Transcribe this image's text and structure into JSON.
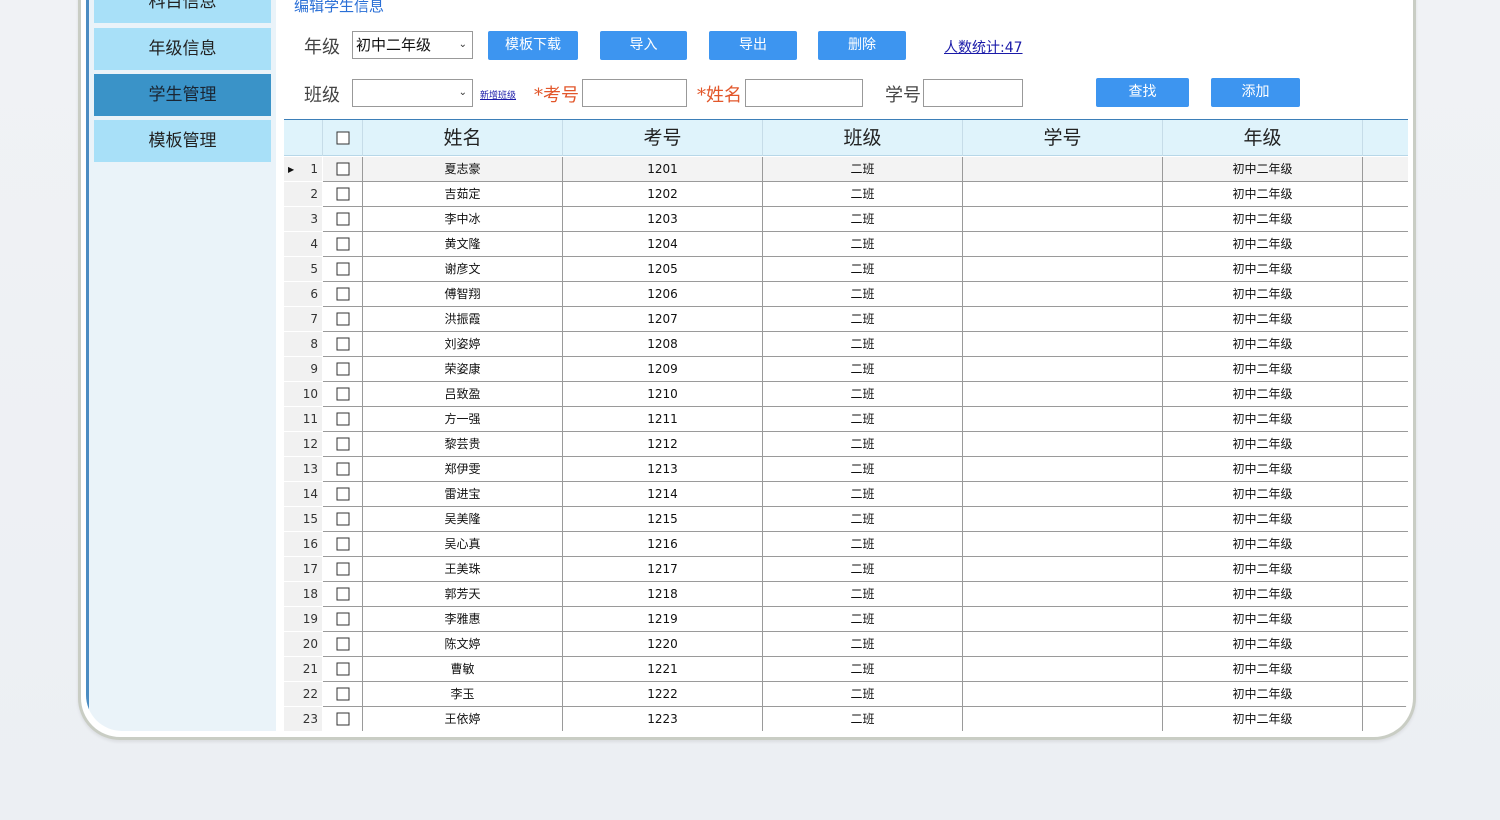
{
  "sidebar": {
    "items": [
      {
        "label": "科目信息"
      },
      {
        "label": "年级信息"
      },
      {
        "label": "学生管理"
      },
      {
        "label": "模板管理"
      }
    ]
  },
  "header": {
    "link_label": "编辑学生信息"
  },
  "filters": {
    "grade_label": "年级",
    "grade_value": "初中二年级",
    "class_label": "班级",
    "class_value": "",
    "add_class_link": "新增班级",
    "exam_no_label": "*考号",
    "name_label": "*姓名",
    "student_no_label": "学号"
  },
  "toolbar": {
    "template_download": "模板下载",
    "import": "导入",
    "export": "导出",
    "delete": "删除",
    "count_label": "人数统计:47",
    "search": "查找",
    "add": "添加"
  },
  "table": {
    "columns": [
      "姓名",
      "考号",
      "班级",
      "学号",
      "年级"
    ],
    "rows": [
      {
        "n": "1",
        "name": "夏志豪",
        "exam": "1201",
        "class": "二班",
        "sno": "",
        "grade": "初中二年级"
      },
      {
        "n": "2",
        "name": "吉茹定",
        "exam": "1202",
        "class": "二班",
        "sno": "",
        "grade": "初中二年级"
      },
      {
        "n": "3",
        "name": "李中冰",
        "exam": "1203",
        "class": "二班",
        "sno": "",
        "grade": "初中二年级"
      },
      {
        "n": "4",
        "name": "黄文隆",
        "exam": "1204",
        "class": "二班",
        "sno": "",
        "grade": "初中二年级"
      },
      {
        "n": "5",
        "name": "谢彦文",
        "exam": "1205",
        "class": "二班",
        "sno": "",
        "grade": "初中二年级"
      },
      {
        "n": "6",
        "name": "傅智翔",
        "exam": "1206",
        "class": "二班",
        "sno": "",
        "grade": "初中二年级"
      },
      {
        "n": "7",
        "name": "洪振霞",
        "exam": "1207",
        "class": "二班",
        "sno": "",
        "grade": "初中二年级"
      },
      {
        "n": "8",
        "name": "刘姿婷",
        "exam": "1208",
        "class": "二班",
        "sno": "",
        "grade": "初中二年级"
      },
      {
        "n": "9",
        "name": "荣姿康",
        "exam": "1209",
        "class": "二班",
        "sno": "",
        "grade": "初中二年级"
      },
      {
        "n": "10",
        "name": "吕致盈",
        "exam": "1210",
        "class": "二班",
        "sno": "",
        "grade": "初中二年级"
      },
      {
        "n": "11",
        "name": "方一强",
        "exam": "1211",
        "class": "二班",
        "sno": "",
        "grade": "初中二年级"
      },
      {
        "n": "12",
        "name": "黎芸贵",
        "exam": "1212",
        "class": "二班",
        "sno": "",
        "grade": "初中二年级"
      },
      {
        "n": "13",
        "name": "郑伊雯",
        "exam": "1213",
        "class": "二班",
        "sno": "",
        "grade": "初中二年级"
      },
      {
        "n": "14",
        "name": "雷进宝",
        "exam": "1214",
        "class": "二班",
        "sno": "",
        "grade": "初中二年级"
      },
      {
        "n": "15",
        "name": "吴美隆",
        "exam": "1215",
        "class": "二班",
        "sno": "",
        "grade": "初中二年级"
      },
      {
        "n": "16",
        "name": "吴心真",
        "exam": "1216",
        "class": "二班",
        "sno": "",
        "grade": "初中二年级"
      },
      {
        "n": "17",
        "name": "王美珠",
        "exam": "1217",
        "class": "二班",
        "sno": "",
        "grade": "初中二年级"
      },
      {
        "n": "18",
        "name": "郭芳天",
        "exam": "1218",
        "class": "二班",
        "sno": "",
        "grade": "初中二年级"
      },
      {
        "n": "19",
        "name": "李雅惠",
        "exam": "1219",
        "class": "二班",
        "sno": "",
        "grade": "初中二年级"
      },
      {
        "n": "20",
        "name": "陈文婷",
        "exam": "1220",
        "class": "二班",
        "sno": "",
        "grade": "初中二年级"
      },
      {
        "n": "21",
        "name": "曹敏",
        "exam": "1221",
        "class": "二班",
        "sno": "",
        "grade": "初中二年级"
      },
      {
        "n": "22",
        "name": "李玉",
        "exam": "1222",
        "class": "二班",
        "sno": "",
        "grade": "初中二年级"
      },
      {
        "n": "23",
        "name": "王依婷",
        "exam": "1223",
        "class": "二班",
        "sno": "",
        "grade": "初中二年级"
      }
    ]
  },
  "icons": {
    "dropdown": "chevron-down-icon",
    "row_marker": "triangle-right-icon",
    "checkbox": "checkbox-icon"
  }
}
